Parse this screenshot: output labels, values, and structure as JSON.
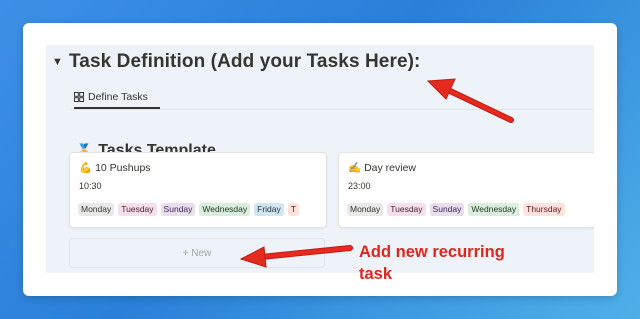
{
  "section": {
    "toggle_icon": "triangle-down-icon",
    "heading": "Task Definition (Add your Tasks Here):"
  },
  "view_tab": {
    "icon": "grid-icon",
    "label": "Define Tasks"
  },
  "database": {
    "emoji": "🏅",
    "title": "Tasks Template"
  },
  "cards": [
    {
      "emoji": "💪",
      "title": "10 Pushups",
      "time": "10:30",
      "tags": [
        "Monday",
        "Tuesday",
        "Sunday",
        "Wednesday",
        "Friday",
        "T"
      ]
    },
    {
      "emoji": "✍️",
      "title": "Day review",
      "time": "23:00",
      "tags": [
        "Monday",
        "Tuesday",
        "Sunday",
        "Wednesday",
        "Thursday"
      ]
    }
  ],
  "new_button": {
    "label": "+ New"
  },
  "annotation": {
    "line1": "Add new recurring",
    "line2": "task",
    "color": "#e1251b"
  },
  "colors": {
    "background": "#2a7fd8",
    "panel": "#edf3f8",
    "text": "#37352f",
    "arrow": "#e1251b"
  }
}
